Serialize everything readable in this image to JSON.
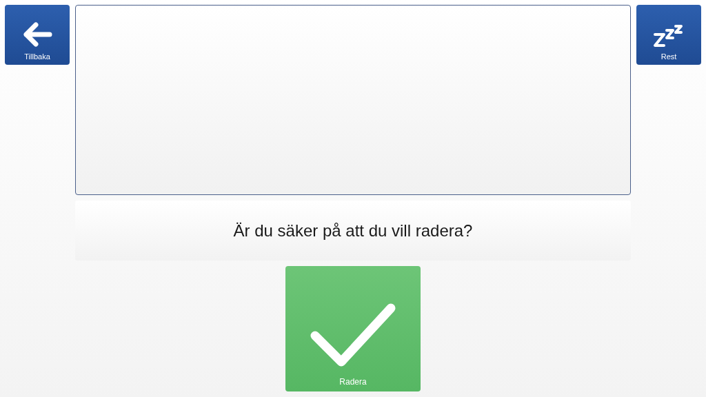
{
  "back_button": {
    "label": "Tillbaka"
  },
  "rest_button": {
    "label": "Rest"
  },
  "message": "Är du säker på att du vill radera?",
  "confirm_button": {
    "label": "Radera"
  }
}
